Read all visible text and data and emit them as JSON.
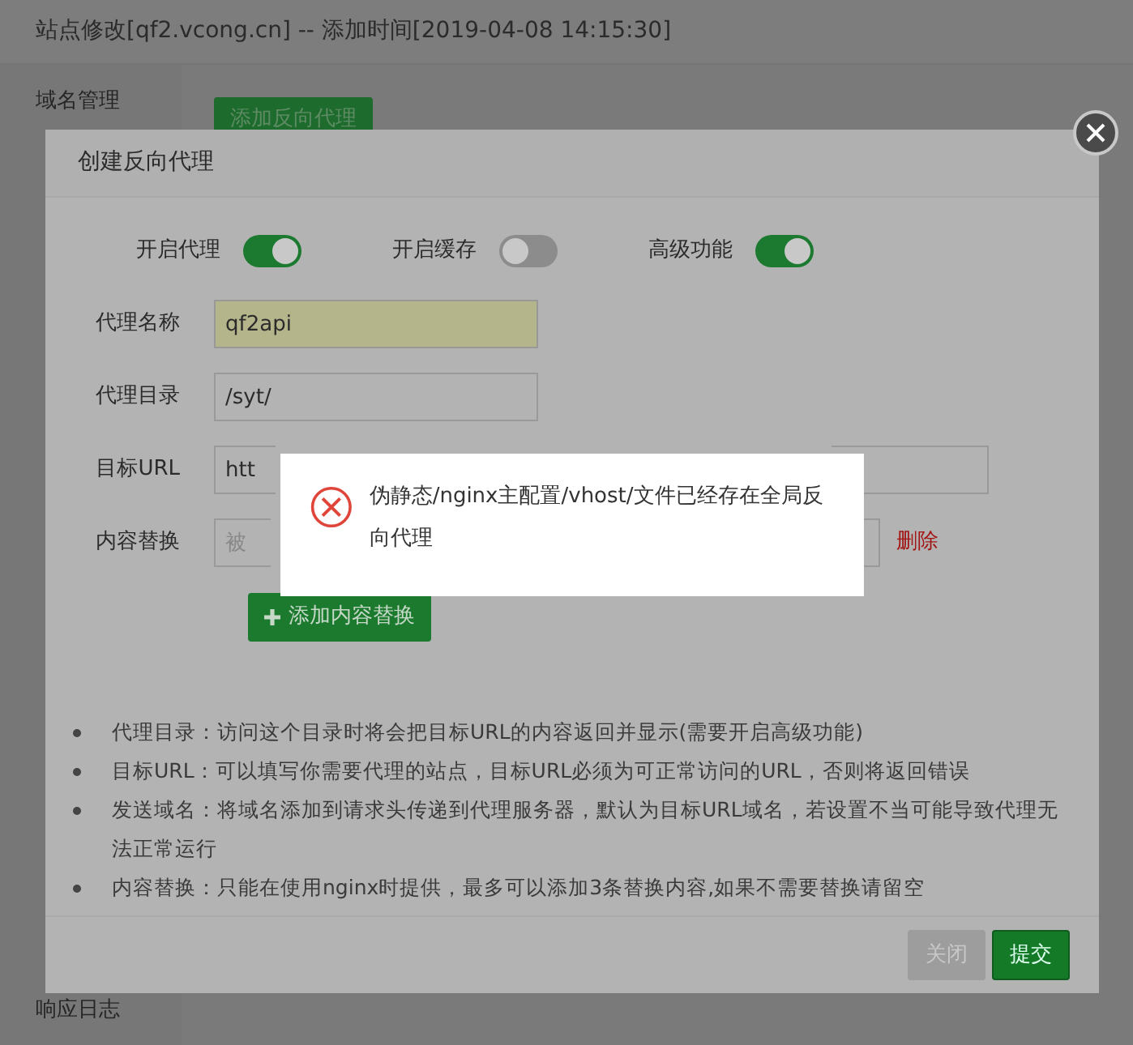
{
  "outer_dialog": {
    "title": "站点修改[qf2.vcong.cn] -- 添加时间[2019-04-08 14:15:30]"
  },
  "sidebar": {
    "items": [
      {
        "label": "域名管理"
      },
      {
        "label": "响应日志"
      }
    ]
  },
  "content": {
    "add_button": "添加反向代理"
  },
  "modal": {
    "title": "创建反向代理",
    "switches": [
      {
        "label": "开启代理",
        "on": true
      },
      {
        "label": "开启缓存",
        "on": false
      },
      {
        "label": "高级功能",
        "on": true
      }
    ],
    "fields": [
      {
        "kind": "text",
        "label": "代理名称",
        "value": "qf2api",
        "autofilled": true
      },
      {
        "kind": "text",
        "label": "代理目录",
        "value": "/syt/",
        "autofilled": false
      },
      {
        "kind": "wide",
        "label": "目标URL",
        "value": "htt",
        "autofilled": false
      },
      {
        "kind": "replace",
        "label": "内容替换",
        "placeholder": "被",
        "delete": "删除"
      }
    ],
    "add_replace_button": "添加内容替换",
    "notes": [
      "代理目录：访问这个目录时将会把目标URL的内容返回并显示(需要开启高级功能)",
      "目标URL：可以填写你需要代理的站点，目标URL必须为可正常访问的URL，否则将返回错误",
      "发送域名：将域名添加到请求头传递到代理服务器，默认为目标URL域名，若设置不当可能导致代理无法正常运行",
      "内容替换：只能在使用nginx时提供，最多可以添加3条替换内容,如果不需要替换请留空"
    ],
    "buttons": [
      {
        "label": "关闭",
        "kind": "close",
        "disabled": true
      },
      {
        "label": "提交",
        "kind": "submit",
        "disabled": false
      }
    ]
  },
  "toast": {
    "message": "伪静态/nginx主配置/vhost/文件已经存在全局反向代理"
  }
}
